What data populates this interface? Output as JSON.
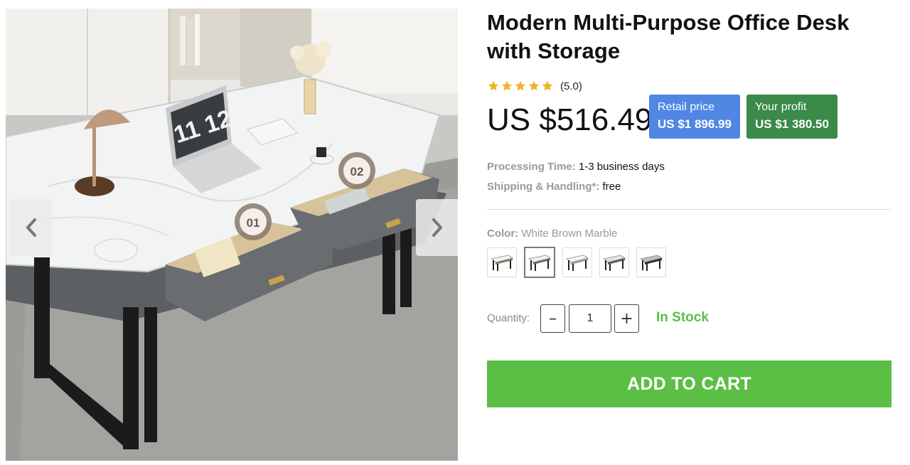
{
  "product": {
    "title": "Modern Multi-Purpose Office Desk with Storage",
    "rating_text": "(5.0)",
    "rating_stars": 5,
    "price": "US $516.49"
  },
  "badges": {
    "retail_label": "Retail price",
    "retail_value": "US $1 896.99",
    "profit_label": "Your profit",
    "profit_value": "US $1 380.50"
  },
  "info": {
    "processing_label": "Processing Time:",
    "processing_value": "1-3 business days",
    "shipping_label": "Shipping & Handling*:",
    "shipping_value": "free"
  },
  "color": {
    "label": "Color:",
    "value": "White Brown Marble",
    "swatch_count": 5,
    "selected_index": 1
  },
  "quantity": {
    "label": "Quantity:",
    "value": "1",
    "minus": "–",
    "plus": "+"
  },
  "stock": "In Stock",
  "add_to_cart": "ADD TO CART",
  "gallery": {
    "laptop_clock": "11 12",
    "marker_1": "01",
    "marker_2": "02"
  },
  "colors": {
    "star": "#f0b429",
    "retail_badge": "#4f87e3",
    "profit_badge": "#3a8a4a",
    "in_stock": "#5bbf4a",
    "add_to_cart": "#5bbf45"
  },
  "icons": {
    "prev": "chevron-left-icon",
    "next": "chevron-right-icon",
    "star": "star-icon"
  }
}
